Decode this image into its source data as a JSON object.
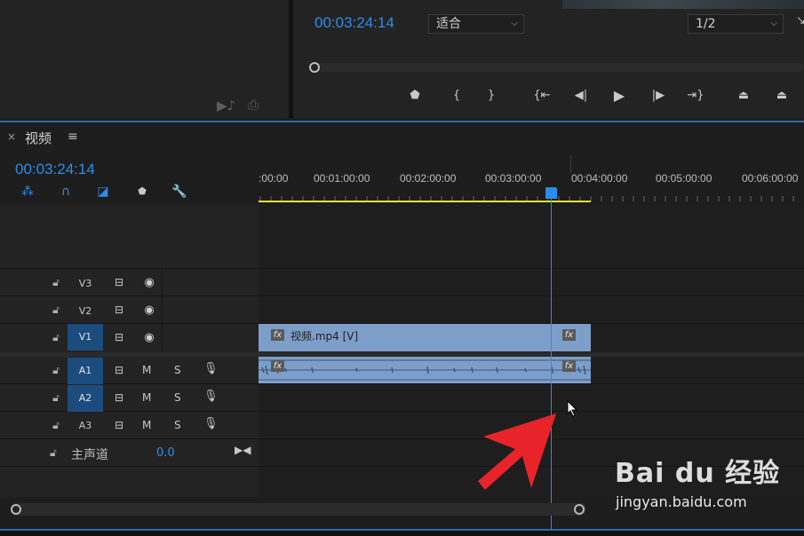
{
  "program_monitor": {
    "timecode": "00:03:24:14",
    "fit_select": {
      "value": "适合"
    },
    "resolution_select": {
      "value": "1/2"
    }
  },
  "timeline": {
    "tab": {
      "close": "×",
      "title": "视频",
      "menu": "≡"
    },
    "timecode": "00:03:24:14",
    "ruler_labels": [
      ":00:00",
      "00:01:00:00",
      "00:02:00:00",
      "00:03:00:00",
      "00:04:00:00",
      "00:05:00:00",
      "00:06:00:00"
    ],
    "video_tracks": [
      {
        "id": "V3",
        "active": false
      },
      {
        "id": "V2",
        "active": false
      },
      {
        "id": "V1",
        "active": true
      }
    ],
    "audio_tracks": [
      {
        "id": "A1",
        "active": true,
        "m": "M",
        "s": "S"
      },
      {
        "id": "A2",
        "active": true,
        "m": "M",
        "s": "S"
      },
      {
        "id": "A3",
        "active": false,
        "m": "M",
        "s": "S"
      }
    ],
    "video_clip": {
      "name": "视频.mp4 [V]",
      "fx": "fx"
    },
    "audio_clip": {
      "fx": "fx"
    },
    "master": {
      "label": "主声道",
      "value": "0.0"
    }
  },
  "watermark": {
    "logo": "Bai du 经验",
    "url": "jingyan.baidu.com"
  },
  "colors": {
    "accent": "#2d8ceb",
    "clip": "#7d9ec9",
    "work_area": "#e6e62c",
    "arrow": "#e8232a"
  }
}
